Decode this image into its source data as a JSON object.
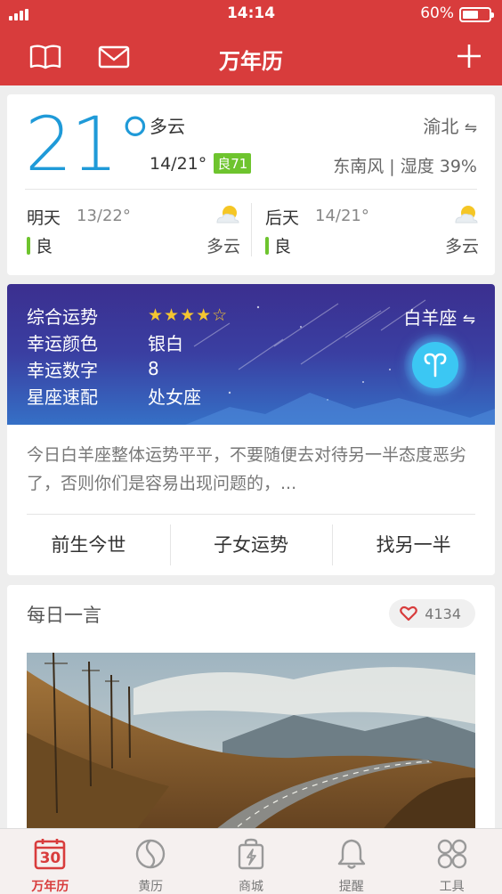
{
  "status_bar": {
    "time": "14:14",
    "battery": "60%",
    "battery_fraction": 0.6
  },
  "nav": {
    "title": "万年历"
  },
  "weather": {
    "temperature": "21°",
    "condition": "多云",
    "range": "14/21°",
    "aqi": "良71",
    "city": "渝北",
    "city_switch_icon": "⇋",
    "wind_humidity": "东南风 | 湿度 39%",
    "tomorrow": {
      "label": "明天",
      "temp": "13/22°",
      "quality": "良",
      "condition": "多云",
      "icon": "partly-cloudy-icon"
    },
    "day_after": {
      "label": "后天",
      "temp": "14/21°",
      "quality": "良",
      "condition": "多云",
      "icon": "partly-cloudy-icon"
    },
    "quality_color": "#6ec42e"
  },
  "horoscope": {
    "rows": [
      {
        "key": "综合运势",
        "value": "★★★★☆"
      },
      {
        "key": "幸运颜色",
        "value": "银白"
      },
      {
        "key": "幸运数字",
        "value": "8"
      },
      {
        "key": "星座速配",
        "value": "处女座"
      }
    ],
    "stars": 4,
    "sign": "白羊座",
    "switch_icon": "⇋",
    "description": "今日白羊座整体运势平平，不要随便去对待另一半态度恶劣了，否则你们是容易出现问题的，...",
    "links": [
      "前生今世",
      "子女运势",
      "找另一半"
    ]
  },
  "quote": {
    "title": "每日一言",
    "likes": "4134"
  },
  "tabbar": {
    "tabs": [
      {
        "label": "万年历",
        "icon": "calendar-icon",
        "day": "30",
        "active": true
      },
      {
        "label": "黄历",
        "icon": "yin-yang-icon"
      },
      {
        "label": "商城",
        "icon": "shopping-bag-icon"
      },
      {
        "label": "提醒",
        "icon": "bell-icon"
      },
      {
        "label": "工具",
        "icon": "grid-circles-icon"
      }
    ]
  },
  "colors": {
    "brand": "#d83c3c",
    "temperature": "#1f9ad8",
    "star": "#f4c531"
  }
}
